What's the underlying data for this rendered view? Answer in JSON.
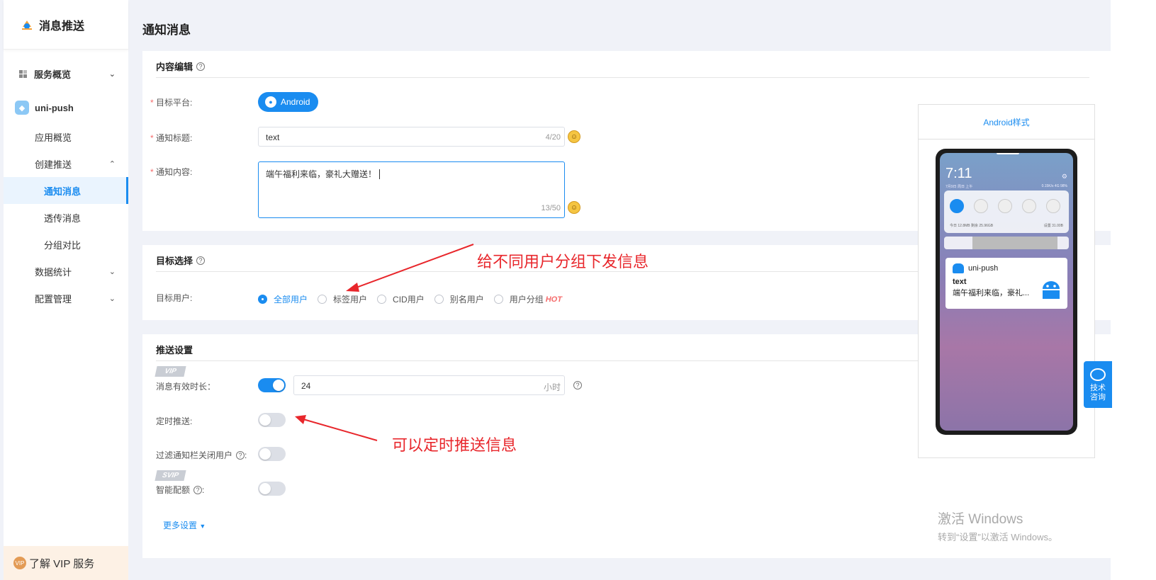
{
  "sidebar": {
    "brand": "消息推送",
    "items": [
      {
        "label": "服务概览"
      },
      {
        "label": "uni-push"
      },
      {
        "label": "应用概览"
      },
      {
        "label": "创建推送"
      },
      {
        "label": "通知消息"
      },
      {
        "label": "透传消息"
      },
      {
        "label": "分组对比"
      },
      {
        "label": "数据统计"
      },
      {
        "label": "配置管理"
      }
    ],
    "vip_label": "了解 VIP 服务",
    "vip_icon_text": "VIP"
  },
  "page_title": "通知消息",
  "content_edit": {
    "title": "内容编辑",
    "platform_label": "目标平台:",
    "platform_value": "Android",
    "title_label": "通知标题:",
    "title_value": "text",
    "title_count": "4/20",
    "content_label": "通知内容:",
    "content_value": "端午福利来临，豪礼大赠送！",
    "content_count": "13/50"
  },
  "target": {
    "title": "目标选择",
    "users_label": "目标用户:",
    "options": [
      "全部用户",
      "标签用户",
      "CID用户",
      "别名用户",
      "用户分组"
    ],
    "selected": "全部用户",
    "hot": "HOT"
  },
  "push_settings": {
    "title": "推送设置",
    "vip_badge": "VIP",
    "svip_badge": "SVIP",
    "valid_label": "消息有效时长：",
    "valid_on": true,
    "valid_value": "24",
    "valid_unit": "小时",
    "timed_label": "定时推送:",
    "timed_on": false,
    "filter_label": "过滤通知栏关闭用户",
    "filter_on": false,
    "smart_label": "智能配额",
    "smart_on": false,
    "more": "更多设置"
  },
  "preview": {
    "header": "Android样式",
    "time": "7:11",
    "date_status": "7月9日 周日 上午",
    "net_status": "0.15K/s 4G 98%",
    "data_usage": "今日 12.8MB  剩余 25.96GB",
    "data_plan": "设置 31.00B",
    "app_name": "uni-push",
    "notif_title": "text",
    "notif_content": "端午福利来临，豪礼..."
  },
  "annotations": {
    "group": "给不同用户分组下发信息",
    "timed": "可以定时推送信息"
  },
  "help_tab": {
    "line1": "技术",
    "line2": "咨询"
  },
  "watermark": {
    "line1": "激活 Windows",
    "line2": "转到“设置”以激活 Windows。"
  },
  "colors": {
    "primary": "#1a8cf0",
    "annotation": "#e8262b",
    "hot": "#f56c6c"
  }
}
